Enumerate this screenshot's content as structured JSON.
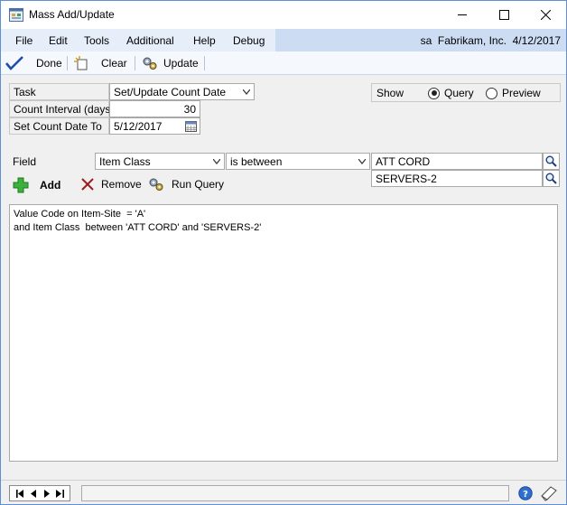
{
  "window": {
    "title": "Mass Add/Update"
  },
  "menu": {
    "items": [
      "File",
      "Edit",
      "Tools",
      "Additional",
      "Help",
      "Debug"
    ],
    "user_info": "sa  Fabrikam, Inc.  4/12/2017"
  },
  "toolbar": {
    "done_label": "Done",
    "clear_label": "Clear",
    "update_label": "Update"
  },
  "form": {
    "task_label": "Task",
    "task_value": "Set/Update Count Date",
    "interval_label": "Count Interval (days)",
    "interval_value": "30",
    "count_date_label": "Set Count Date To",
    "count_date_value": "5/12/2017",
    "show_label": "Show",
    "show_options": [
      "Query",
      "Preview"
    ],
    "show_selected": "Query",
    "field_label": "Field",
    "field_value": "Item Class",
    "operator_value": "is between",
    "from_value": "ATT CORD",
    "to_value": "SERVERS-2"
  },
  "actions": {
    "add_label": "Add",
    "remove_label": "Remove",
    "run_query_label": "Run Query"
  },
  "query_lines": [
    "Value Code on Item-Site  = 'A'",
    "and Item Class  between 'ATT CORD' and 'SERVERS-2'"
  ],
  "colors": {
    "title_border": "#5b8fd6",
    "menu_band": "#ccdcf2",
    "done_check": "#1d4fa8",
    "add_plus": "#3bb03b",
    "remove_x": "#9b1c1c"
  }
}
